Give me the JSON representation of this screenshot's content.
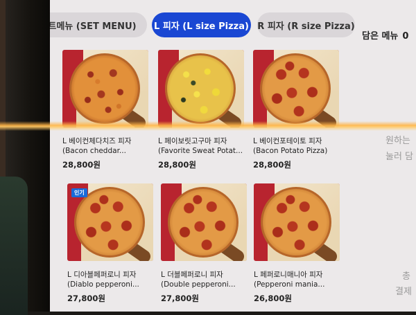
{
  "tabs": [
    {
      "label": "세트메뉴 (SET MENU)",
      "active": false
    },
    {
      "label": "L 피자 (L size Pizza)",
      "active": true
    },
    {
      "label": "R 피자 (R size Pizza)",
      "active": false
    }
  ],
  "cart": {
    "label": "담은 메뉴",
    "count": "0"
  },
  "accent_color": "#1a47d3",
  "products": [
    {
      "name_ko": "L 베이컨체다치즈 피자",
      "name_en": "(Bacon cheddar...",
      "price": "28,800원",
      "badge": "",
      "image": "pizza-bacon-cheddar"
    },
    {
      "name_ko": "L 페이보릿고구마 피자",
      "name_en": "(Favorite Sweat Potat...",
      "price": "28,800원",
      "badge": "",
      "image": "pizza-sweet-potato"
    },
    {
      "name_ko": "L 베이컨포테이토 피자",
      "name_en": "(Bacon Potato Pizza)",
      "price": "28,800원",
      "badge": "",
      "image": "pizza-bacon-potato"
    },
    {
      "name_ko": "L 디아블페퍼로니 피자",
      "name_en": "(Diablo pepperoni...",
      "price": "27,800원",
      "badge": "인기",
      "image": "pizza-diablo-pepperoni"
    },
    {
      "name_ko": "L 더블페퍼로니 피자",
      "name_en": "(Double pepperoni...",
      "price": "27,800원",
      "badge": "",
      "image": "pizza-double-pepperoni"
    },
    {
      "name_ko": "L 페퍼로니매니아 피자",
      "name_en": "(Pepperoni mania...",
      "price": "26,800원",
      "badge": "",
      "image": "pizza-pepperoni-mania"
    }
  ],
  "side_panel": {
    "line1": "원하는",
    "line2": "눌러 담",
    "line3": "총",
    "line4": "결제"
  }
}
